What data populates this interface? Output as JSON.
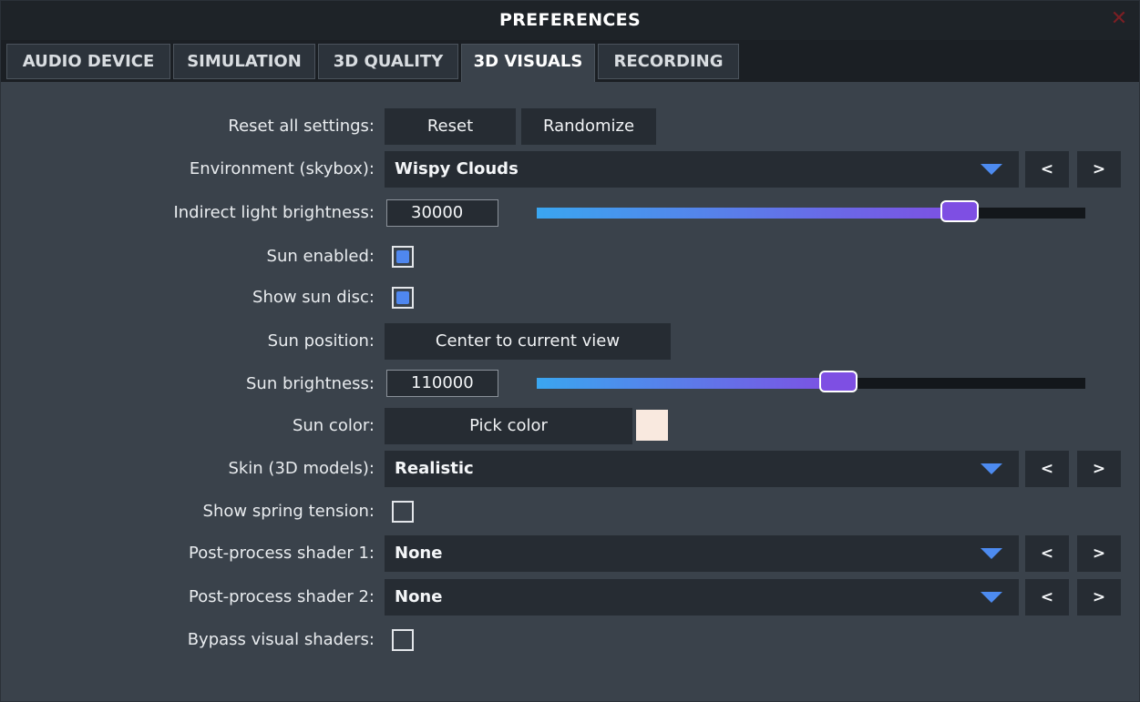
{
  "window": {
    "title": "PREFERENCES",
    "close_glyph": "✕"
  },
  "tabs": [
    {
      "label": "AUDIO DEVICE",
      "active": false
    },
    {
      "label": "SIMULATION",
      "active": false
    },
    {
      "label": "3D QUALITY",
      "active": false
    },
    {
      "label": "3D VISUALS",
      "active": true
    },
    {
      "label": "RECORDING",
      "active": false
    }
  ],
  "settings": {
    "reset": {
      "label": "Reset all settings:",
      "reset_button": "Reset",
      "randomize_button": "Randomize"
    },
    "environment": {
      "label": "Environment (skybox):",
      "value": "Wispy Clouds",
      "prev": "<",
      "next": ">"
    },
    "indirect_light": {
      "label": "Indirect light brightness:",
      "value": "30000",
      "slider_level_percent": 77
    },
    "sun_enabled": {
      "label": "Sun enabled:",
      "checked": true
    },
    "show_sun_disc": {
      "label": "Show sun disc:",
      "checked": true
    },
    "sun_position": {
      "label": "Sun position:",
      "button": "Center to current view"
    },
    "sun_brightness": {
      "label": "Sun brightness:",
      "value": "110000",
      "slider_level_percent": 55
    },
    "sun_color": {
      "label": "Sun color:",
      "button": "Pick color",
      "swatch_color": "#f9e9df"
    },
    "skin": {
      "label": "Skin (3D models):",
      "value": "Realistic",
      "prev": "<",
      "next": ">"
    },
    "spring_tension": {
      "label": "Show spring tension:",
      "checked": false
    },
    "shader1": {
      "label": "Post-process shader 1:",
      "value": "None",
      "prev": "<",
      "next": ">"
    },
    "shader2": {
      "label": "Post-process shader 2:",
      "value": "None",
      "prev": "<",
      "next": ">"
    },
    "bypass_shaders": {
      "label": "Bypass visual shaders:",
      "checked": false
    }
  },
  "colors": {
    "accent_blue": "#4d8bf0",
    "slider_gradient_start": "#3aa6f0",
    "slider_gradient_end": "#7e4fe3",
    "close_red": "#7a1f24"
  }
}
